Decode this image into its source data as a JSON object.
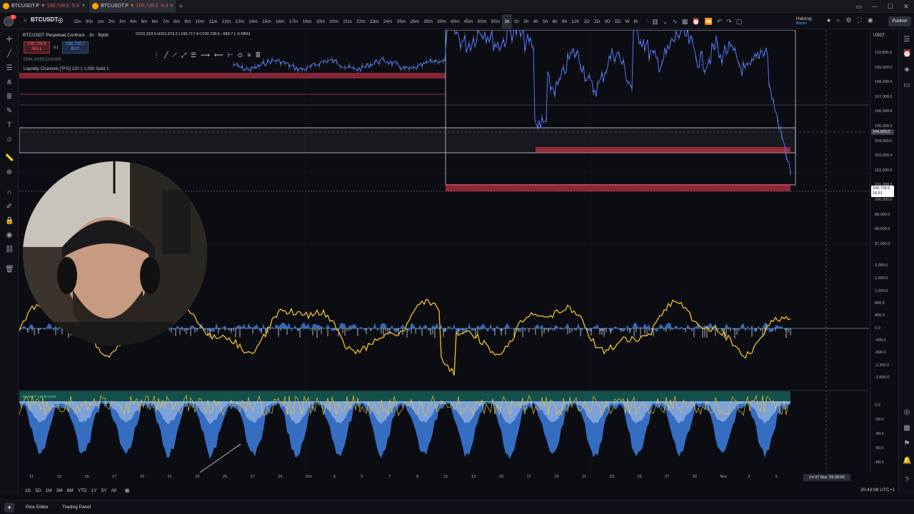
{
  "tabs": [
    {
      "symbol": "BTCUSDT.P",
      "price": "▼ 100,728.6",
      "change": "-5.4"
    },
    {
      "symbol": "BTCUSDT.P",
      "price": "▼ 100,728.6",
      "change": "-5.4"
    }
  ],
  "header": {
    "symbol": "BTCUSDT",
    "intervals": [
      "15s",
      "30s",
      "1m",
      "2m",
      "3m",
      "4m",
      "5m",
      "6m",
      "7m",
      "8m",
      "9m",
      "10m",
      "11m",
      "12m",
      "13m",
      "14m",
      "15m",
      "16m",
      "17m",
      "18m",
      "19m",
      "20m",
      "21m",
      "22m",
      "23m",
      "24m",
      "25m",
      "26m",
      "28m",
      "30m",
      "40m",
      "45m",
      "50m",
      "55m",
      "1h",
      "2h",
      "3h",
      "4h",
      "5h",
      "6h",
      "8h",
      "12h",
      "1D",
      "2D",
      "3D",
      "5D",
      "W",
      "M"
    ],
    "active_interval": "1h",
    "halving_label": "Halving",
    "halving_sub": "Bitcoin",
    "publish_label": "Publish",
    "logo_badge": "11"
  },
  "legend": {
    "title": "BTCUSDT Perpetual Contract · 1h · Bybit",
    "ohlc": "O101,318.3  H101,673.2  L100,717.4  C100,728.6  −589.7 (−0.58%)",
    "sell_price": "100,728.6",
    "sell_label": "SELL",
    "buy_price": "100,728.7",
    "buy_label": "BUY",
    "spread": "0.1",
    "ema": "EMA 20/50/100/200",
    "liquidity": "Liquidity Channels [TFO] 120 1 1,000 Solid 1"
  },
  "price_axis": {
    "currency": "USDT",
    "labels": [
      "110,000.0",
      "109,000.0",
      "108,000.0",
      "107,000.0",
      "106,000.0",
      "105,000.0",
      "104,000.0",
      "103,000.0",
      "102,000.0",
      "101,000.0",
      "100,000.0",
      "99,000.0",
      "98,000.0",
      "97,000.0",
      "2,000.0",
      "1,600.0",
      "1,200.0",
      "800.0",
      "400.0",
      "0.0",
      "-400.0",
      "-800.0",
      "-1,200.0",
      "-1,600.0",
      "0.0",
      "-20.0",
      "-40.0",
      "-60.0",
      "-80.0"
    ],
    "cursor_price": "104,620.0",
    "current_price": "100,728.6",
    "current_time": "16:51"
  },
  "time_axis": {
    "labels": [
      "11",
      "13",
      "15",
      "17",
      "19",
      "21",
      "23",
      "25",
      "27",
      "29",
      "Oct",
      "3",
      "5",
      "7",
      "9",
      "11",
      "13",
      "15",
      "17",
      "19",
      "21",
      "23",
      "25",
      "27",
      "29",
      "Nov",
      "3",
      "5"
    ],
    "crosshair_date": "Fri 07 Nov '25  09:00"
  },
  "bottom": {
    "ranges": [
      "1D",
      "5D",
      "1M",
      "3M",
      "6M",
      "YTD",
      "1Y",
      "5Y",
      "All"
    ],
    "clock": "20:43:08 UTC+1",
    "pine_editor": "Pine Editor",
    "trading_panel": "Trading Panel"
  },
  "indicator": {
    "market_label": "MARKET LIBERATION"
  },
  "colors": {
    "price": "#4f77ff",
    "liquidity_red": "#e53950",
    "oscillator_yellow": "#f2c230",
    "histogram_blue": "#3d7fe0",
    "background": "#0b0d12"
  }
}
